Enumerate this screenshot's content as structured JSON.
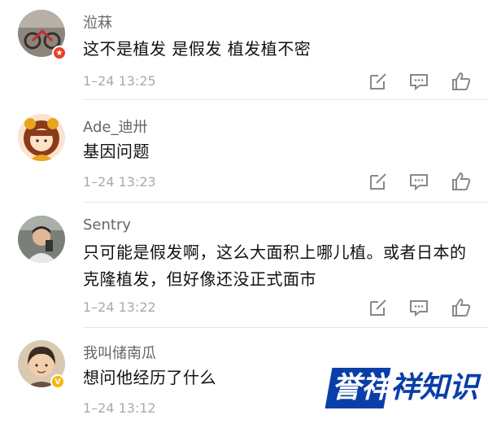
{
  "comments": [
    {
      "username": "涖菻",
      "text": "这不是植发 是假发 植发植不密",
      "time": "1–24 13:25",
      "badge": "vip-red"
    },
    {
      "username": "Ade_迪卅",
      "text": "基因问题",
      "time": "1–24 13:23"
    },
    {
      "username": "Sentry",
      "text": "只可能是假发啊，这么大面积上哪儿植。或者日本的克隆植发，但好像还没正式面市",
      "time": "1–24 13:22"
    },
    {
      "username": "我叫储南瓜",
      "text": "想问他经历了什么",
      "time": "1–24 13:12",
      "badge": "verified-yellow"
    }
  ],
  "actions": {
    "icons": [
      "edit-icon",
      "comment-icon",
      "like-icon"
    ]
  },
  "watermark": {
    "text_1": "誉",
    "text_2": "祥",
    "text_3": "祥知识"
  },
  "colors": {
    "username": "#666666",
    "time": "#aaaaaa",
    "logo_blue": "#0a3ea8",
    "badge_red": "#e8412c",
    "badge_yellow": "#f5b800"
  }
}
